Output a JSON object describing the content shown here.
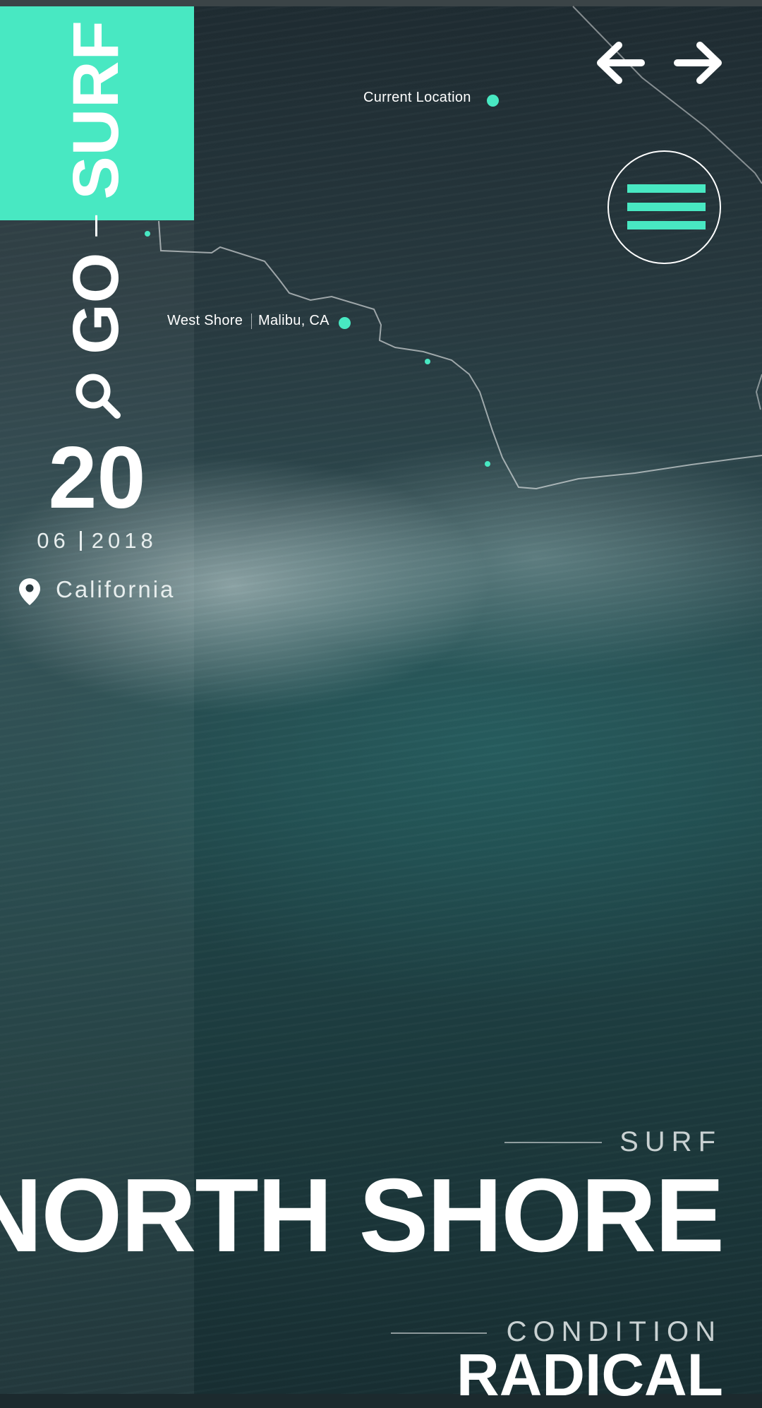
{
  "brand": {
    "word_go": "GO",
    "word_surf": "SURF"
  },
  "date": {
    "day": "20",
    "month": "06",
    "year": "2018"
  },
  "location": {
    "name": "California"
  },
  "map": {
    "current_location_label": "Current Location",
    "west_shore_label": "West Shore",
    "malibu_label": "Malibu, CA"
  },
  "hero": {
    "eyebrow": "SURF",
    "title": "NORTH SHORE",
    "condition_label": "CONDITION",
    "condition_value": "RADICAL"
  },
  "colors": {
    "accent": "#48e8c2",
    "text": "#ffffff",
    "muted": "#c9d1d2"
  },
  "icons": [
    "search-icon",
    "location-pin-icon",
    "arrow-left-icon",
    "arrow-right-icon",
    "menu-icon"
  ]
}
